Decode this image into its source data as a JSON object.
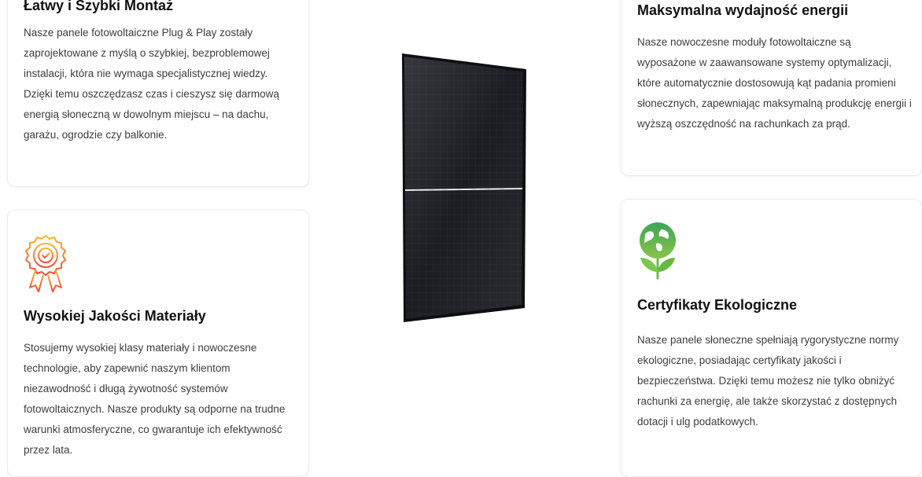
{
  "cards": {
    "top_left": {
      "title": "Łatwy i Szybki Montaż",
      "text": "Nasze panele fotowoltaiczne Plug & Play zostały zaprojektowane z myślą o szybkiej, bezproblemowej instalacji, która nie wymaga specjalistycznej wiedzy. Dzięki temu oszczędzasz czas i cieszysz się darmową energią słoneczną w dowolnym miejscu – na dachu, garażu, ogrodzie czy balkonie."
    },
    "bottom_left": {
      "icon": "quality-badge-icon",
      "title": "Wysokiej Jakości Materiały",
      "text": "Stosujemy wysokiej klasy materiały i nowoczesne technologie, aby zapewnić naszym klientom niezawodność i długą żywotność systemów fotowoltaicznych. Nasze produkty są odporne na trudne warunki atmosferyczne, co gwarantuje ich efektywność przez lata."
    },
    "top_right": {
      "title": "Maksymalna wydajność energii",
      "text": "Nasze nowoczesne moduły fotowoltaiczne są wyposażone w zaawansowane systemy optymalizacji, które automatycznie dostosowują kąt padania promieni słonecznych, zapewniając maksymalną produkcję energii i wyższą oszczędność na rachunkach za prąd."
    },
    "bottom_right": {
      "icon": "eco-globe-leaf-icon",
      "title": "Certyfikaty Ekologiczne",
      "text": "Nasze panele słoneczne spełniają rygorystyczne normy ekologiczne, posiadając certyfikaty jakości i bezpieczeństwa. Dzięki temu możesz nie tylko obniżyć rachunki za energię, ale także skorzystać z dostępnych dotacji i ulg podatkowych."
    }
  },
  "colors": {
    "badge_orange": "#f08a24",
    "eco_green": "#4caf50",
    "title": "#111111",
    "text": "#3d3d3d"
  }
}
